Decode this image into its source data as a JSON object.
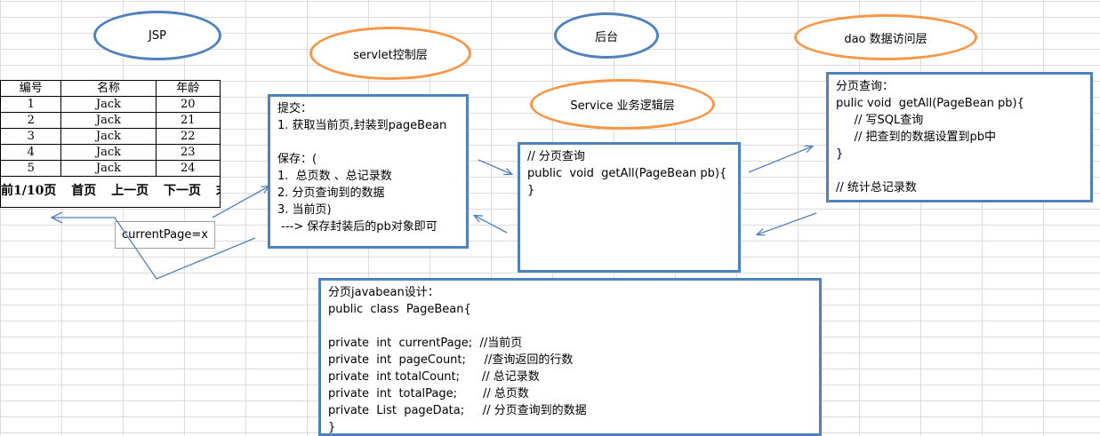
{
  "ellipses": {
    "jsp": "JSP",
    "servlet": "servlet控制层",
    "backend": "后台",
    "service": "Service 业务逻辑层",
    "dao": "dao 数据访问层"
  },
  "table": {
    "headers": [
      "编号",
      "名称",
      "年龄"
    ],
    "rows": [
      [
        "1",
        "Jack",
        "20"
      ],
      [
        "2",
        "Jack",
        "21"
      ],
      [
        "3",
        "Jack",
        "22"
      ],
      [
        "4",
        "Jack",
        "23"
      ],
      [
        "5",
        "Jack",
        "24"
      ]
    ],
    "pager": [
      "前1/10页",
      "首页",
      "上一页",
      "下一页",
      "末"
    ]
  },
  "current_page_label": "currentPage=x",
  "servlet_box": "提交：\n1. 获取当前页,封装到pageBean\n\n保存：(\n1.  总页数 、总记录数\n2. 分页查询到的数据\n3. 当前页)\n ---> 保存封装后的pb对象即可",
  "service_box": "// 分页查询\npublic  void  getAll(PageBean pb){\n}",
  "dao_box": "分页查询：\npulic void  getAll(PageBean pb){\n     // 写SQL查询\n     // 把查到的数据设置到pb中\n}\n\n// 统计总记录数",
  "javabean_box": "分页javabean设计：\npublic  class  PageBean{\n\nprivate  int  currentPage;  //当前页\nprivate  int  pageCount;     //查询返回的行数\nprivate  int totalCount;      // 总记录数\nprivate  int  totalPage;       // 总页数\nprivate  List  pageData;     // 分页查询到的数据\n}",
  "colors": {
    "blue": "#4f81bd",
    "orange": "#f79646",
    "grid": "#dadcdd"
  }
}
